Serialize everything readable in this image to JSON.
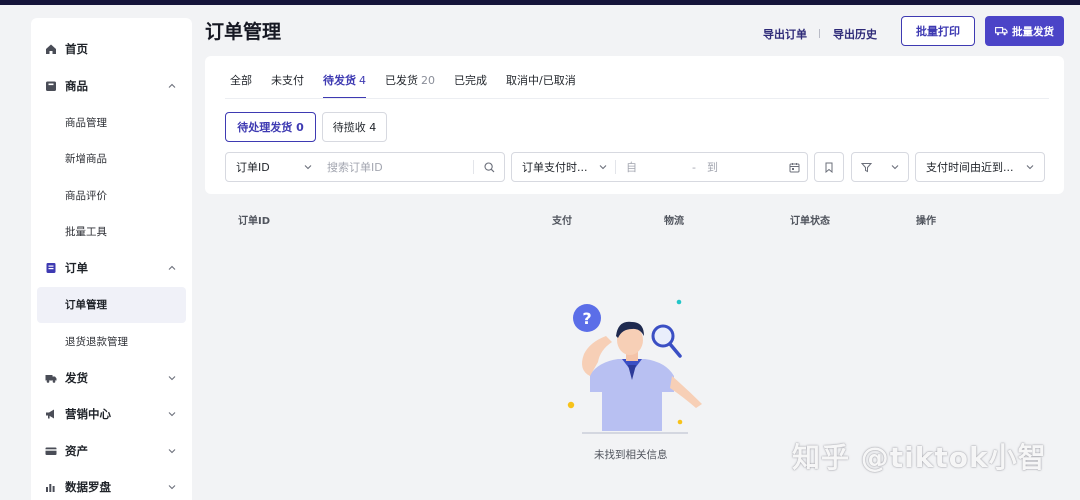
{
  "page": {
    "title": "订单管理"
  },
  "header": {
    "export_orders": "导出订单",
    "export_history": "导出历史",
    "batch_print": "批量打印",
    "batch_ship": "批量发货"
  },
  "sidebar": {
    "items": [
      {
        "label": "首页",
        "icon": "home-icon"
      },
      {
        "label": "商品",
        "icon": "product-icon",
        "expanded": true,
        "children": [
          "商品管理",
          "新增商品",
          "商品评价",
          "批量工具"
        ]
      },
      {
        "label": "订单",
        "icon": "order-icon",
        "expanded": true,
        "children": [
          "订单管理",
          "退货退款管理"
        ],
        "active_child": "订单管理"
      },
      {
        "label": "发货",
        "icon": "truck-icon",
        "expanded": false
      },
      {
        "label": "营销中心",
        "icon": "megaphone-icon",
        "expanded": false
      },
      {
        "label": "资产",
        "icon": "card-icon",
        "expanded": false
      },
      {
        "label": "数据罗盘",
        "icon": "chart-icon",
        "expanded": false
      }
    ]
  },
  "tabs": [
    {
      "label": "全部",
      "count": ""
    },
    {
      "label": "未支付",
      "count": ""
    },
    {
      "label": "待发货",
      "count": "4",
      "active": true
    },
    {
      "label": "已发货",
      "count": "20"
    },
    {
      "label": "已完成",
      "count": ""
    },
    {
      "label": "取消中/已取消",
      "count": ""
    }
  ],
  "sub_tabs": [
    {
      "label": "待处理发货 0",
      "active": true
    },
    {
      "label": "待揽收 4"
    }
  ],
  "filters": {
    "search_type": "订单ID",
    "search_placeholder": "搜索订单ID",
    "date_type": "订单支付时...",
    "date_from": "自",
    "date_dash": "-",
    "date_to": "到",
    "sort": "支付时间由近到..."
  },
  "table": {
    "columns": [
      "订单ID",
      "支付",
      "物流",
      "订单状态",
      "操作"
    ]
  },
  "empty_state": {
    "text": "未找到相关信息"
  },
  "watermark": "知乎 @tiktok小智",
  "colors": {
    "accent": "#3e3ab2",
    "primary_button": "#4b44c7",
    "topbar": "#15143a"
  }
}
